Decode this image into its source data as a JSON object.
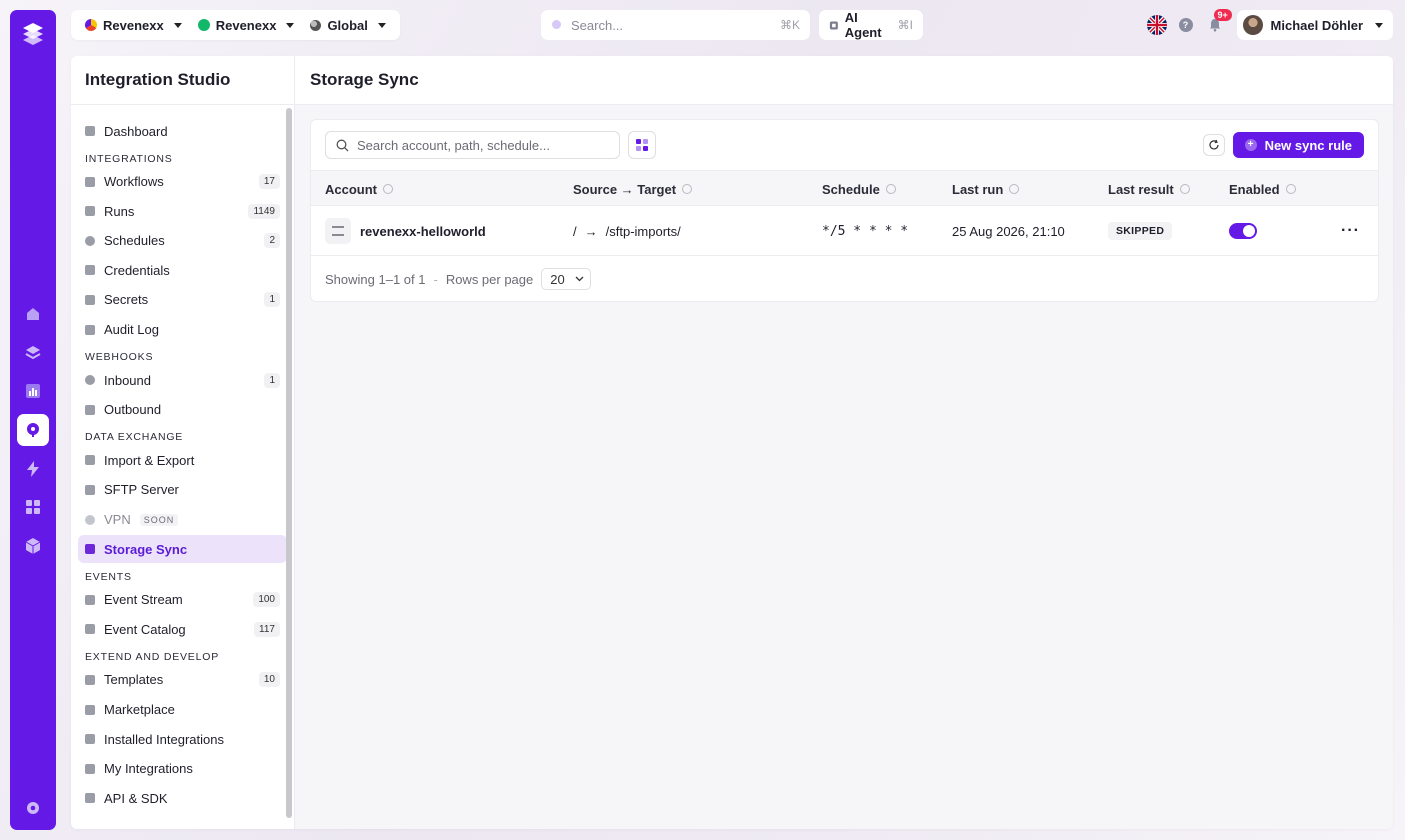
{
  "topbar": {
    "org_selector": "Revenexx",
    "workspace_selector": "Revenexx",
    "region_selector": "Global",
    "search_placeholder": "Search...",
    "search_shortcut": "⌘K",
    "ai_agent_label": "AI Agent",
    "ai_agent_shortcut": "⌘I",
    "help_label": "?",
    "notifications_badge": "9+",
    "user_name": "Michael Döhler"
  },
  "sidebar": {
    "title": "Integration Studio",
    "dashboard": "Dashboard",
    "sections": {
      "integrations": "INTEGRATIONS",
      "webhooks": "WEBHOOKS",
      "data_exchange": "DATA EXCHANGE",
      "events": "EVENTS",
      "extend": "EXTEND AND DEVELOP"
    },
    "items": {
      "workflows": {
        "label": "Workflows",
        "count": "17"
      },
      "runs": {
        "label": "Runs",
        "count": "1149"
      },
      "schedules": {
        "label": "Schedules",
        "count": "2"
      },
      "credentials": {
        "label": "Credentials"
      },
      "secrets": {
        "label": "Secrets",
        "count": "1"
      },
      "audit_log": {
        "label": "Audit Log"
      },
      "inbound": {
        "label": "Inbound",
        "count": "1"
      },
      "outbound": {
        "label": "Outbound"
      },
      "import_export": {
        "label": "Import & Export"
      },
      "sftp_server": {
        "label": "SFTP Server"
      },
      "vpn": {
        "label": "VPN",
        "badge": "SOON"
      },
      "storage_sync": {
        "label": "Storage Sync"
      },
      "event_stream": {
        "label": "Event Stream",
        "count": "100"
      },
      "event_catalog": {
        "label": "Event Catalog",
        "count": "117"
      },
      "templates": {
        "label": "Templates",
        "count": "10"
      },
      "marketplace": {
        "label": "Marketplace"
      },
      "installed": {
        "label": "Installed Integrations"
      },
      "my_integrations": {
        "label": "My Integrations"
      },
      "api_sdk": {
        "label": "API & SDK"
      }
    }
  },
  "main": {
    "title": "Storage Sync",
    "search_placeholder": "Search account, path, schedule...",
    "new_button": "New sync rule",
    "columns": {
      "account": "Account",
      "source_target": "Source → Target",
      "schedule": "Schedule",
      "last_run": "Last run",
      "last_result": "Last result",
      "enabled": "Enabled"
    },
    "rows": [
      {
        "account": "revenexx-helloworld",
        "source": "/",
        "arrow": "→",
        "target": "/sftp-imports/",
        "schedule": "*/5 * * * *",
        "last_run": "25 Aug 2026, 21:10",
        "last_result": "SKIPPED",
        "enabled": true,
        "actions": "···"
      }
    ],
    "pager": {
      "showing": "Showing 1–1 of 1",
      "separator": "-",
      "rows_label": "Rows per page",
      "rows_value": "20"
    }
  },
  "colors": {
    "brand": "#6419e6",
    "active_bg": "#ece3fb",
    "notification": "#ef2b4f"
  }
}
